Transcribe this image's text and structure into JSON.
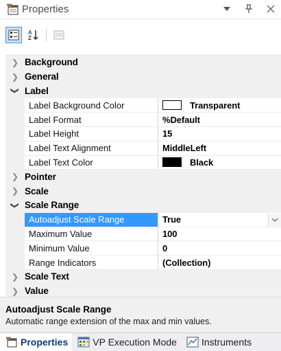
{
  "window": {
    "title": "Properties",
    "controls": [
      "dropdown-arrow",
      "pin",
      "close"
    ]
  },
  "toolbar": {
    "buttons": [
      "categorized-icon",
      "alphabetical-sort-icon",
      "property-pages-icon"
    ],
    "sort_label": "AZ"
  },
  "grid": {
    "cat_background": "Background",
    "cat_general": "General",
    "cat_label": "Label",
    "label_props": [
      {
        "name": "Label Background Color",
        "value": "Transparent",
        "swatch": "#ffffff"
      },
      {
        "name": "Label Format",
        "value": "%Default"
      },
      {
        "name": "Label Height",
        "value": "15"
      },
      {
        "name": "Label Text Alignment",
        "value": "MiddleLeft"
      },
      {
        "name": "Label Text Color",
        "value": "Black",
        "swatch": "#000000"
      }
    ],
    "cat_pointer": "Pointer",
    "cat_scale": "Scale",
    "cat_scale_range": "Scale Range",
    "range_props": [
      {
        "name": "Autoadjust Scale Range",
        "value": "True",
        "selected": true
      },
      {
        "name": "Maximum Value",
        "value": "100"
      },
      {
        "name": "Minimum Value",
        "value": "0"
      },
      {
        "name": "Range Indicators",
        "value": "(Collection)"
      }
    ],
    "cat_scale_text": "Scale Text",
    "cat_value": "Value"
  },
  "description": {
    "title": "Autoadjust Scale Range",
    "text": "Automatic range extension of the max and min values."
  },
  "tabs": [
    {
      "label": "Properties",
      "active": true
    },
    {
      "label": "VP Execution Mode",
      "active": false
    },
    {
      "label": "Instruments",
      "active": false
    }
  ],
  "colors": {
    "selection": "#3399ff",
    "category_bg": "#f0f0f0",
    "active_tab_text": "#0e3b73"
  }
}
